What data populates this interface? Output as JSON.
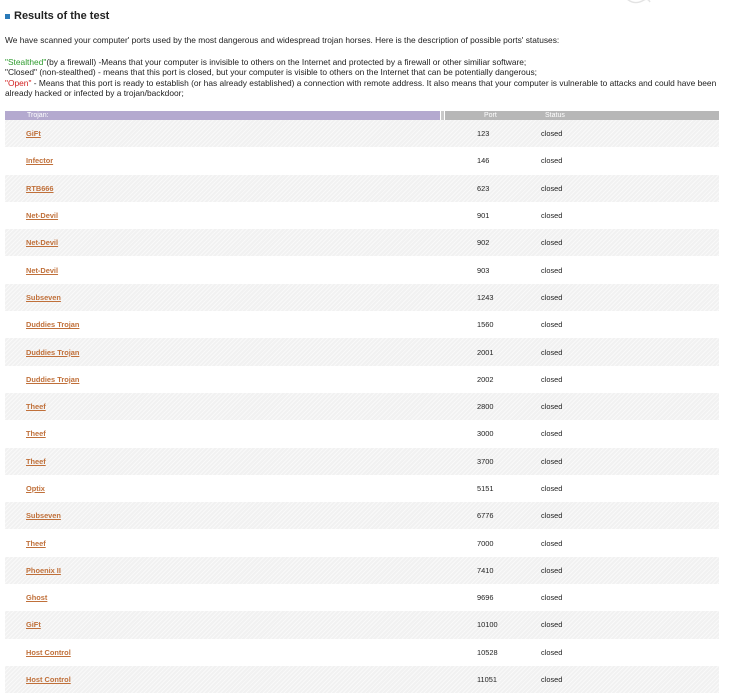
{
  "header": {
    "title": "Results of the test"
  },
  "intro": {
    "text": "We have scanned your computer' ports used by the most dangerous and widespread trojan horses. Here is the description of possible ports' statuses:"
  },
  "statuses": {
    "stealthed_label": "\"Stealthed\"",
    "stealthed_desc": "(by a firewall) -Means that your computer is invisible to others on the Internet and protected by a firewall or other similiar software;",
    "closed_label": "\"Closed\"",
    "closed_desc": " (non-stealthed) - means that this port is closed, but your computer is visible to others on the Internet that can be potentially dangerous;",
    "open_label": "\"Open\"",
    "open_desc": " - Means that this port is ready to establish (or has already established) a connection with remote address. It also means that your computer is vulnerable to attacks and could have been already hacked or infected by a trojan/backdoor;"
  },
  "colors": {
    "stealthed": "#2e9b2e",
    "open": "#d22020",
    "link": "#c0703a",
    "header_trojan": "#b4a9cf",
    "header_other": "#b7b7b7",
    "title_marker": "#2a7ab8"
  },
  "table": {
    "columns": {
      "trojan": "Trojan:",
      "port": "Port",
      "status": "Status"
    },
    "rows": [
      {
        "trojan": "GiFt",
        "port": "123",
        "status": "closed"
      },
      {
        "trojan": "Infector",
        "port": "146",
        "status": "closed"
      },
      {
        "trojan": "RTB666",
        "port": "623",
        "status": "closed"
      },
      {
        "trojan": "Net-Devil",
        "port": "901",
        "status": "closed"
      },
      {
        "trojan": "Net-Devil",
        "port": "902",
        "status": "closed"
      },
      {
        "trojan": "Net-Devil",
        "port": "903",
        "status": "closed"
      },
      {
        "trojan": "Subseven",
        "port": "1243",
        "status": "closed"
      },
      {
        "trojan": "Duddies Trojan",
        "port": "1560",
        "status": "closed"
      },
      {
        "trojan": "Duddies Trojan",
        "port": "2001",
        "status": "closed"
      },
      {
        "trojan": "Duddies Trojan",
        "port": "2002",
        "status": "closed"
      },
      {
        "trojan": "Theef",
        "port": "2800",
        "status": "closed"
      },
      {
        "trojan": "Theef",
        "port": "3000",
        "status": "closed"
      },
      {
        "trojan": "Theef",
        "port": "3700",
        "status": "closed"
      },
      {
        "trojan": "Optix",
        "port": "5151",
        "status": "closed"
      },
      {
        "trojan": "Subseven",
        "port": "6776",
        "status": "closed"
      },
      {
        "trojan": "Theef",
        "port": "7000",
        "status": "closed"
      },
      {
        "trojan": "Phoenix II",
        "port": "7410",
        "status": "closed"
      },
      {
        "trojan": "Ghost",
        "port": "9696",
        "status": "closed"
      },
      {
        "trojan": "GiFt",
        "port": "10100",
        "status": "closed"
      },
      {
        "trojan": "Host Control",
        "port": "10528",
        "status": "closed"
      },
      {
        "trojan": "Host Control",
        "port": "11051",
        "status": "closed"
      }
    ]
  }
}
